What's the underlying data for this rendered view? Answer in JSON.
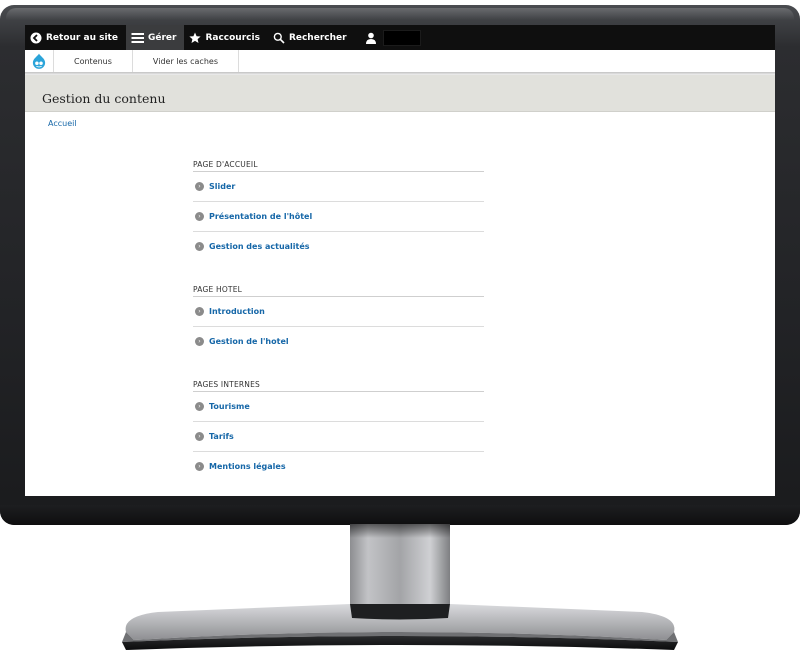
{
  "toolbar": {
    "back_label": "Retour au site",
    "manage_label": "Gérer",
    "shortcuts_label": "Raccourcis",
    "search_label": "Rechercher"
  },
  "tray": {
    "items": [
      "Contenus",
      "Vider les caches"
    ]
  },
  "page": {
    "title": "Gestion du contenu",
    "breadcrumb": "Accueil"
  },
  "sections": [
    {
      "title": "PAGE D'ACCUEIL",
      "items": [
        "Slider",
        "Présentation de l'hôtel",
        "Gestion des actualités"
      ]
    },
    {
      "title": "PAGE HOTEL",
      "items": [
        "Introduction",
        "Gestion de l'hotel"
      ]
    },
    {
      "title": "PAGES INTERNES",
      "items": [
        "Tourisme",
        "Tarifs",
        "Mentions légales"
      ]
    }
  ],
  "icons": {
    "back": "circle-chevron-left-icon",
    "manage": "hamburger-menu-icon",
    "shortcuts": "star-icon",
    "search": "magnifier-icon",
    "user": "user-icon",
    "logo": "drupal-drop-icon",
    "item_arrow": "circle-arrow-right-icon"
  },
  "colors": {
    "toolbar_bg": "#0f0f0f",
    "toolbar_active": "#3b3c3e",
    "title_band": "#e1e1dc",
    "link": "#1667a8",
    "logo_blue": "#2ba4d9"
  }
}
